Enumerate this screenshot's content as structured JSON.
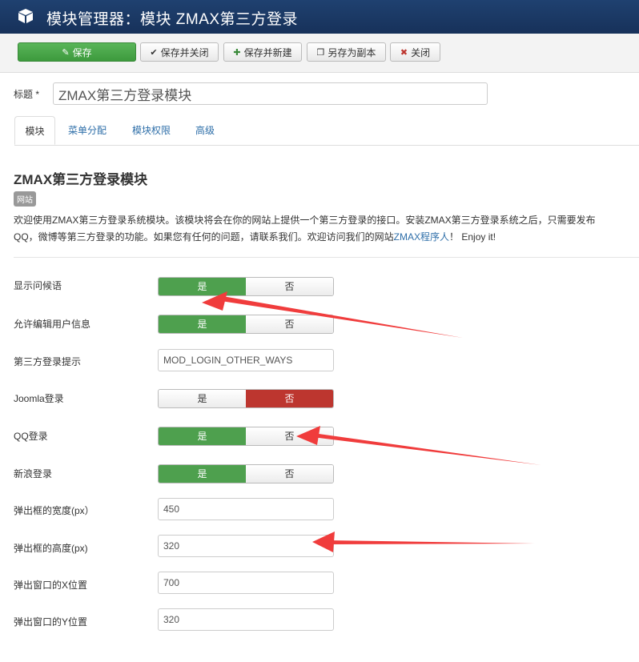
{
  "header": {
    "title": "模块管理器：模块 ZMAX第三方登录",
    "icon": "cube-icon"
  },
  "toolbar": {
    "save": "保存",
    "save_close": "保存并关闭",
    "save_new": "保存并新建",
    "save_copy": "另存为副本",
    "close": "关闭"
  },
  "title_field": {
    "label": "标题 *",
    "value": "ZMAX第三方登录模块"
  },
  "tabs": [
    "模块",
    "菜单分配",
    "模块权限",
    "高级"
  ],
  "module": {
    "title": "ZMAX第三方登录模块",
    "badge": "网站",
    "desc_line1": "欢迎使用ZMAX第三方登录系统模块。该模块将会在你的网站上提供一个第三方登录的接口。安装ZMAX第三方登录系统之后，只需要发布",
    "desc_line2_a": "QQ，微博等第三方登录的功能。如果您有任何的问题，请联系我们。欢迎访问我们的网站",
    "desc_link": "ZMAX程序人",
    "desc_line2_b": "！ Enjoy it!"
  },
  "toggle_labels": {
    "yes": "是",
    "no": "否"
  },
  "fields": {
    "greeting": {
      "label": "显示问候语",
      "value": "是"
    },
    "allow_edit": {
      "label": "允许编辑用户信息",
      "value": "是"
    },
    "hint": {
      "label": "第三方登录提示",
      "value": "MOD_LOGIN_OTHER_WAYS"
    },
    "joomla": {
      "label": "Joomla登录",
      "value": "否"
    },
    "qq": {
      "label": "QQ登录",
      "value": "是"
    },
    "weibo": {
      "label": "新浪登录",
      "value": "是"
    },
    "popup_width": {
      "label": "弹出框的宽度(px）",
      "value": "450"
    },
    "popup_height": {
      "label": "弹出框的高度(px)",
      "value": "320"
    },
    "popup_x": {
      "label": "弹出窗口的X位置",
      "value": "700"
    },
    "popup_y": {
      "label": "弹出窗口的Y位置",
      "value": "320"
    }
  },
  "colors": {
    "header": "#1a3867",
    "green": "#4ea04e",
    "red": "#bd362f",
    "annotation": "#f03c3c"
  }
}
